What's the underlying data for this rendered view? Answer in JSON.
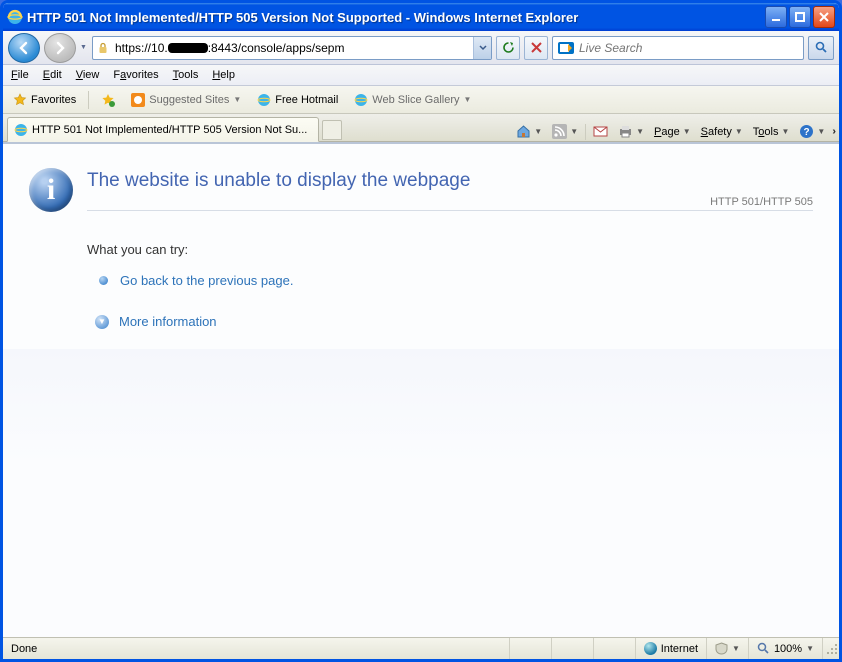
{
  "window": {
    "title": "HTTP 501 Not Implemented/HTTP 505 Version Not Supported - Windows Internet Explorer"
  },
  "address": {
    "prefix": "https://10.",
    "suffix": ":8443/console/apps/sepm"
  },
  "search": {
    "placeholder": "Live Search"
  },
  "menu": {
    "file": "File",
    "edit": "Edit",
    "view": "View",
    "favorites": "Favorites",
    "tools": "Tools",
    "help": "Help"
  },
  "favbar": {
    "favorites": "Favorites",
    "suggested": "Suggested Sites",
    "hotmail": "Free Hotmail",
    "webslice": "Web Slice Gallery"
  },
  "tab": {
    "title": "HTTP 501 Not Implemented/HTTP 505 Version Not Su..."
  },
  "cmd": {
    "page": "Page",
    "safety": "Safety",
    "tools": "Tools"
  },
  "error": {
    "heading": "The website is unable to display the webpage",
    "code": "HTTP 501/HTTP 505",
    "try": "What you can try:",
    "goback": "Go back to the previous page.",
    "more": "More information"
  },
  "status": {
    "done": "Done",
    "zone": "Internet",
    "zoom": "100%"
  }
}
